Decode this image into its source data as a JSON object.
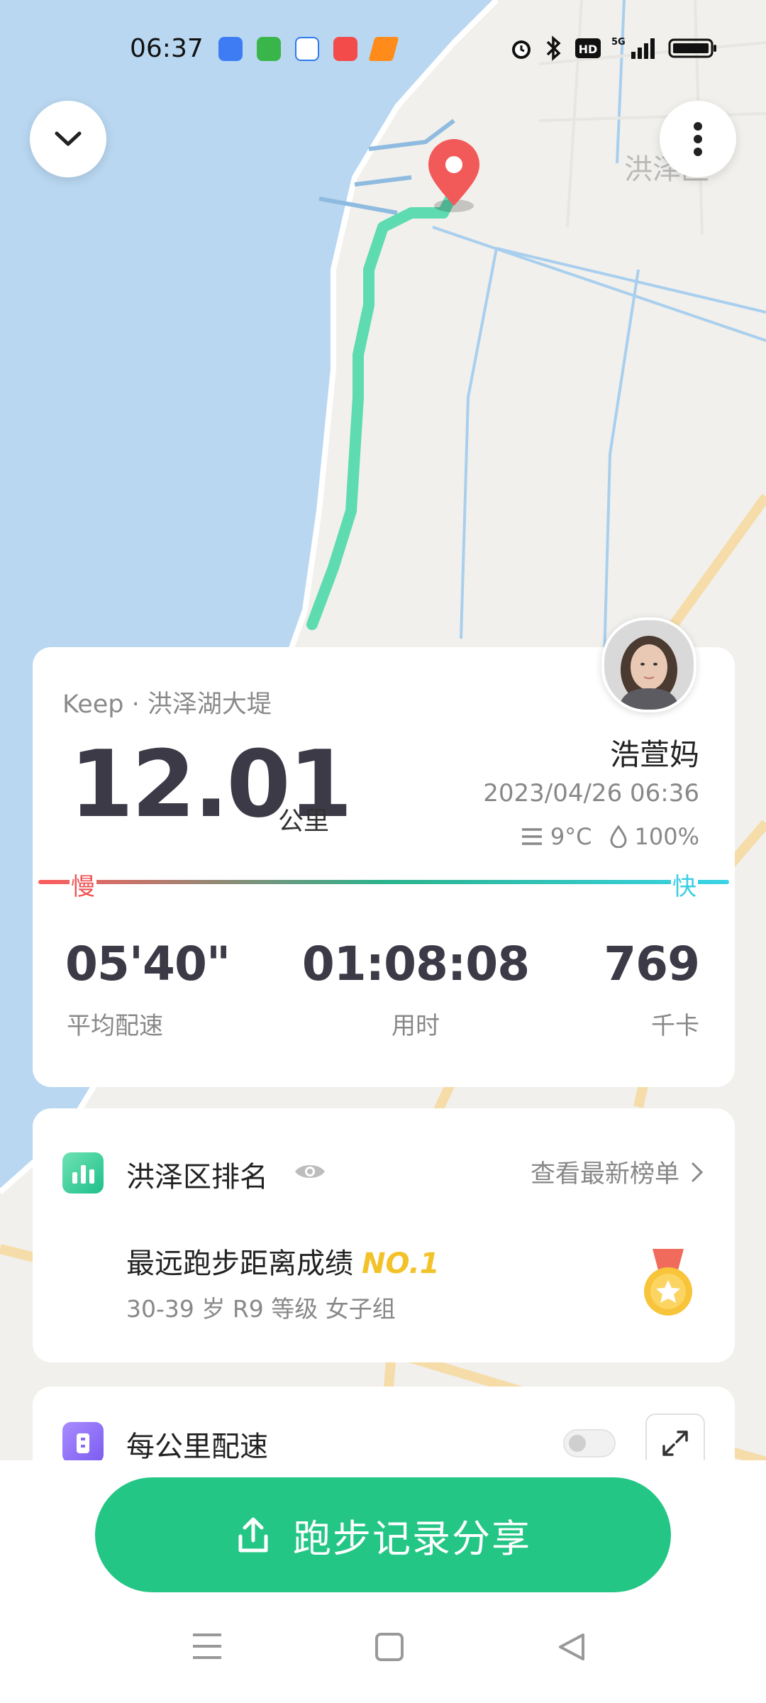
{
  "status_bar": {
    "time": "06:37"
  },
  "map": {
    "label": "洪泽区"
  },
  "summary": {
    "source": "Keep · 洪泽湖大堤",
    "distance": "12.01",
    "distance_unit": "公里",
    "user_name": "浩萱妈",
    "datetime": "2023/04/26 06:36",
    "temperature": "9°C",
    "humidity": "100%",
    "slow_label": "慢",
    "fast_label": "快",
    "stats": [
      {
        "value": "05'40\"",
        "label": "平均配速"
      },
      {
        "value": "01:08:08",
        "label": "用时"
      },
      {
        "value": "769",
        "label": "千卡"
      }
    ]
  },
  "ranking": {
    "title": "洪泽区排名",
    "link": "查看最新榜单",
    "achievement": "最远跑步距离成绩",
    "rank": "NO.1",
    "group": "30-39 岁 R9 等级 女子组"
  },
  "pace_section": {
    "title": "每公里配速"
  },
  "share_button": {
    "label": "跑步记录分享"
  },
  "colors": {
    "accent": "#24c685",
    "slow": "#ef5353",
    "fast": "#3ccfe3",
    "gold": "#f3c229"
  }
}
